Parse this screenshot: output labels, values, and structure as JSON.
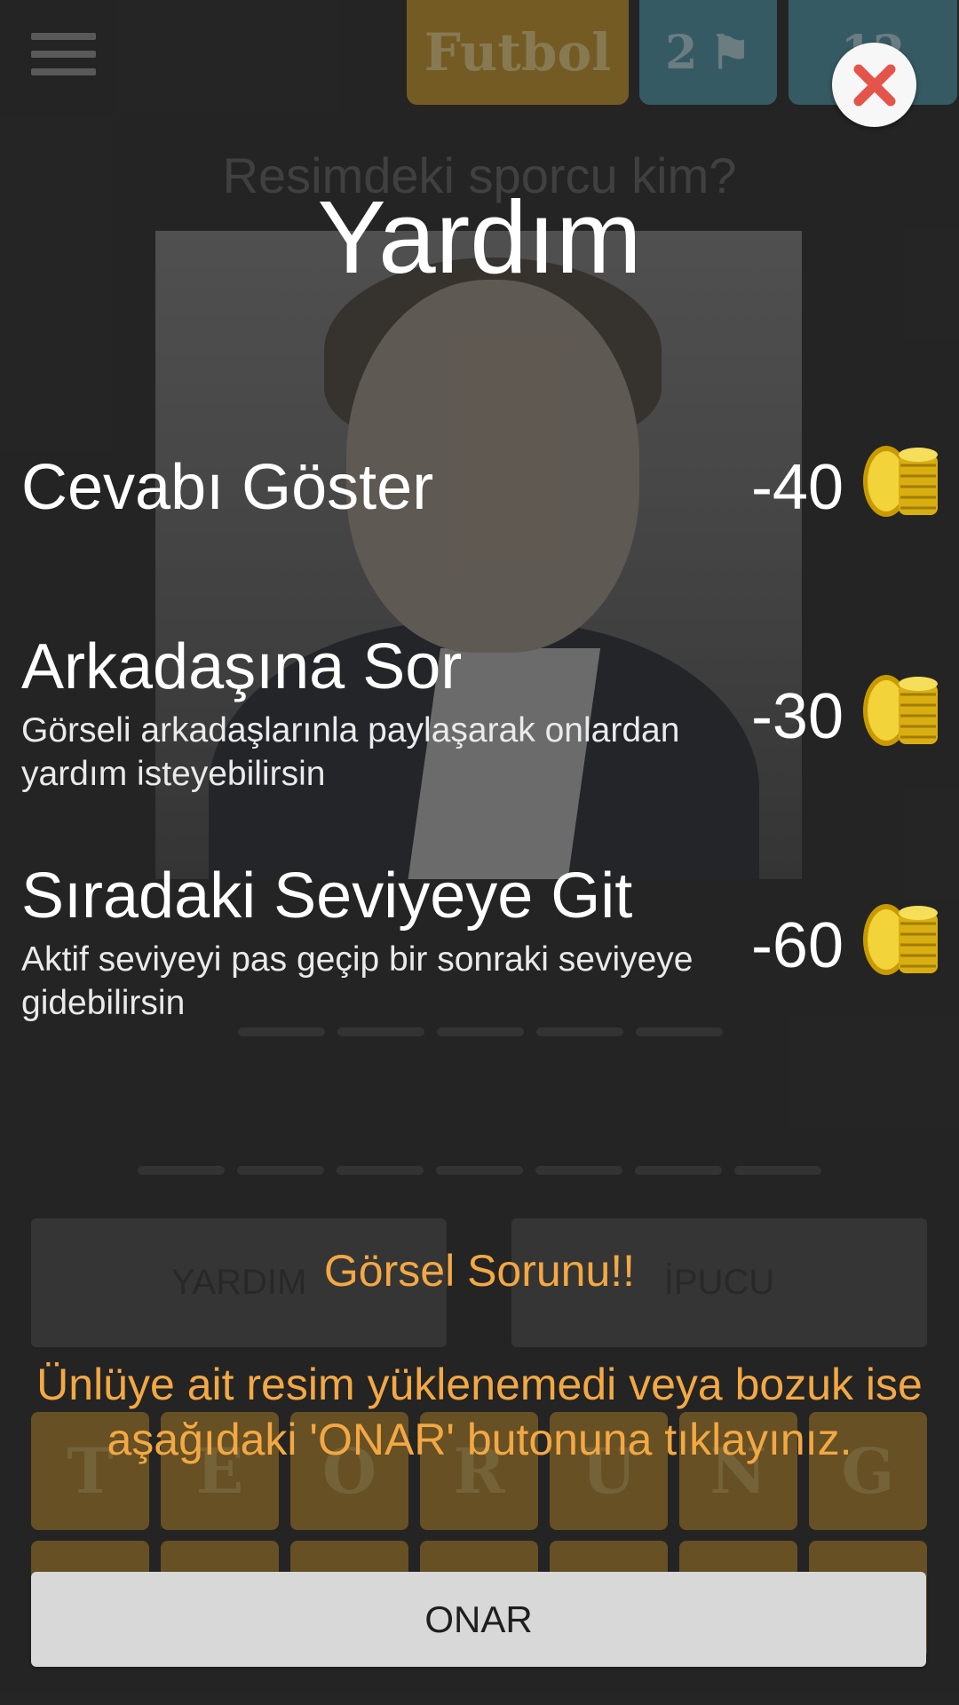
{
  "game": {
    "category": "Futbol",
    "level": "2",
    "coins": "12",
    "question": "Resimdeki sporcu kim?",
    "help_button_label": "YARDIM",
    "hint_button_label": "İPUCU",
    "letter_tiles": [
      "T",
      "E",
      "O",
      "R",
      "U",
      "N",
      "G"
    ]
  },
  "popup": {
    "title": "Yardım",
    "close_icon": "close-x-icon",
    "options": [
      {
        "title": "Cevabı Göster",
        "description": "",
        "cost": "-40",
        "icon": "gold-coins-icon"
      },
      {
        "title": "Arkadaşına Sor",
        "description": "Görseli arkadaşlarınla paylaşarak onlardan yardım isteyebilirsin",
        "cost": "-30",
        "icon": "gold-coins-icon"
      },
      {
        "title": "Sıradaki Seviyeye Git",
        "description": "Aktif seviyeyi pas geçip bir sonraki seviyeye gidebilirsin",
        "cost": "-60",
        "icon": "gold-coins-icon"
      }
    ],
    "notice_title": "Görsel Sorunu!!",
    "notice_text": "Ünlüye ait resim yüklenemedi veya bozuk ise aşağıdaki 'ONAR' butonuna tıklayınız.",
    "repair_button_label": "ONAR"
  },
  "colors": {
    "accent_orange": "#f3a843",
    "close_red": "#e5544b",
    "coin_gold": "#e8c21a",
    "popup_overlay": "#3f3f3f"
  }
}
